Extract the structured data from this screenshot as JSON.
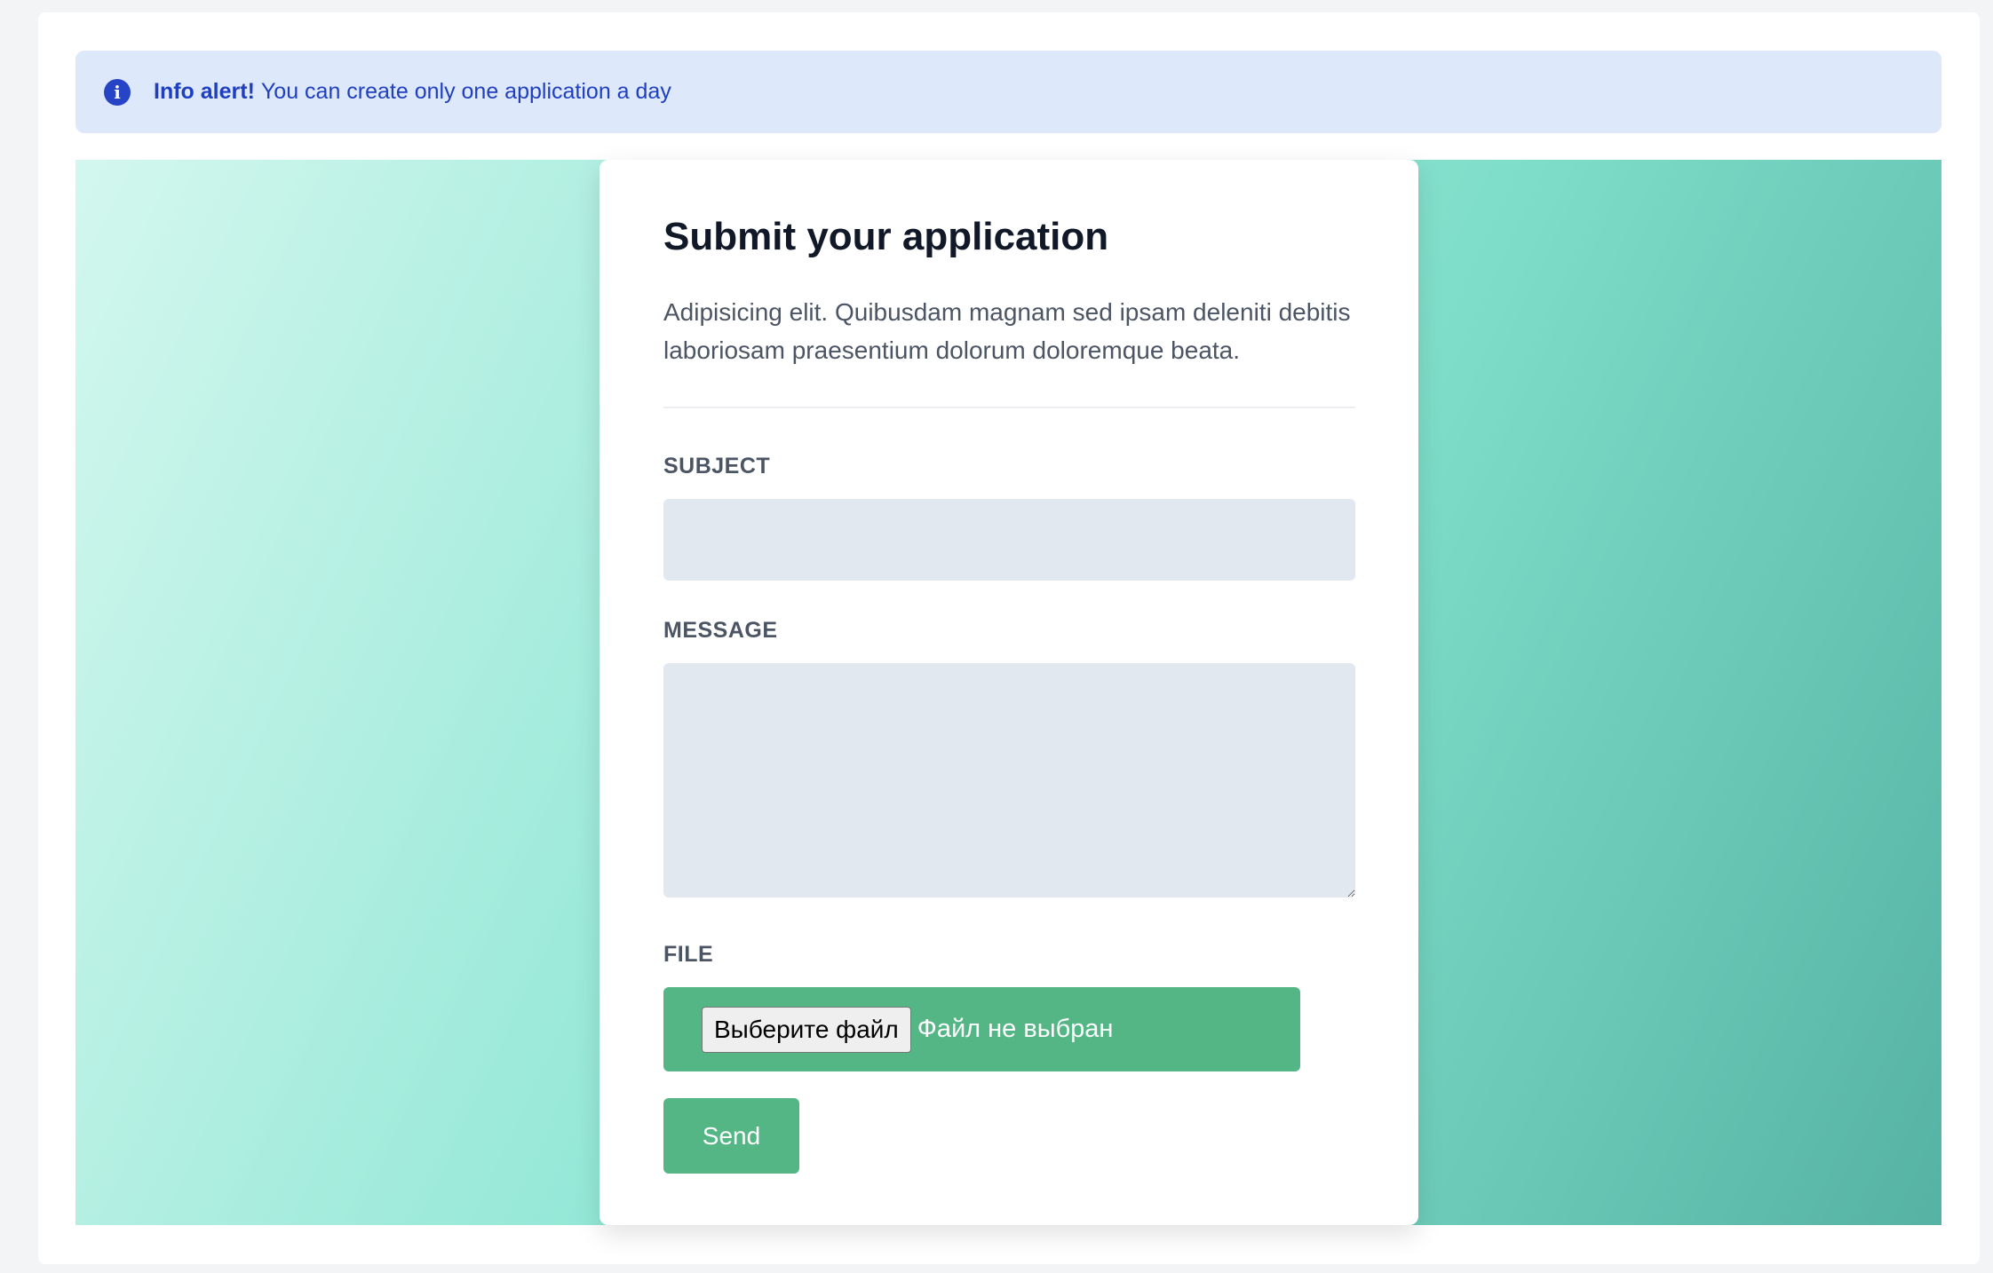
{
  "alert": {
    "icon": "info-icon",
    "icon_glyph": "i",
    "title": "Info alert!",
    "message": "You can create only one application a day",
    "color": "#1f3fbf",
    "background": "#dde8fa"
  },
  "form": {
    "title": "Submit your application",
    "description": "Adipisicing elit. Quibusdam magnam sed ipsam deleniti debitis laboriosam praesentium dolorum doloremque beata.",
    "subject": {
      "label": "SUBJECT",
      "value": ""
    },
    "message": {
      "label": "MESSAGE",
      "value": ""
    },
    "file": {
      "label": "FILE",
      "button_label": "Выберите файл",
      "status": "Файл не выбран"
    },
    "send_label": "Send",
    "accent_color": "#55b685"
  }
}
